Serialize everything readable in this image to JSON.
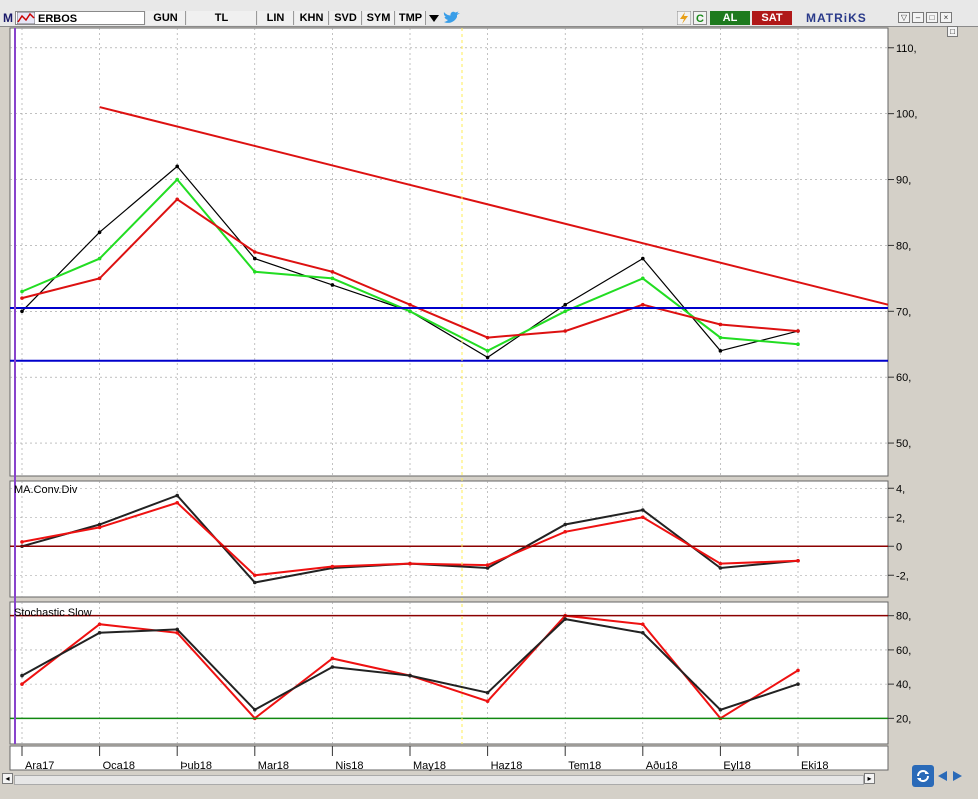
{
  "toolbar": {
    "logo": "M",
    "symbol": "ERBOS",
    "buttons": [
      "GUN",
      "TL",
      "LIN",
      "KHN",
      "SVD",
      "SYM",
      "TMP"
    ],
    "buy_label": "AL",
    "sell_label": "SAT",
    "brand": "MATRiKS",
    "refresh_label": "C"
  },
  "colors": {
    "price_bars": "#000000",
    "ma_fast": "#22dd22",
    "ma_slow": "#dd1111",
    "trendline": "#dd1111",
    "horizontal_lines": "#0000cc",
    "macd": "#222222",
    "macd_signal": "#ee1111",
    "stoch_k": "#ee1111",
    "stoch_d": "#222222",
    "zero_line": "#8b0000",
    "stoch_lower": "#118811",
    "cursor_line": "#ffee55",
    "left_marker": "#8844cc"
  },
  "chart_data": [
    {
      "type": "line",
      "name": "price",
      "x": [
        "Ara17",
        "Oca18",
        "Şub18",
        "Mar18",
        "Nis18",
        "May18",
        "Haz18",
        "Tem18",
        "Ağu18",
        "Eyl18",
        "Eki18"
      ],
      "date_labels": [
        "Ara17",
        "Oca18",
        "Þub18",
        "Mar18",
        "Nis18",
        "May18",
        "Haz18",
        "Tem18",
        "Aðu18",
        "Eyl18",
        "Eki18"
      ],
      "series": [
        {
          "values": [
            70,
            82,
            92,
            78,
            74,
            70,
            63,
            71,
            78,
            64,
            67
          ]
        },
        {
          "values": [
            73,
            78,
            90,
            76,
            75,
            70,
            64,
            70,
            75,
            66,
            65
          ]
        },
        {
          "values": [
            72,
            75,
            87,
            79,
            76,
            71,
            66,
            67,
            71,
            68,
            67
          ]
        }
      ],
      "ylim": [
        45,
        113
      ],
      "yticks": [
        50,
        60,
        70,
        80,
        90,
        100,
        110
      ],
      "ytick_labels": [
        "50,",
        "60,",
        "70,",
        "80,",
        "90,",
        "100,",
        "110,"
      ],
      "horizontal_lines": [
        70.5,
        62.5
      ],
      "trendline": {
        "from": [
          "Oca18",
          101
        ],
        "to": [
          "Eki18",
          71
        ]
      },
      "grid": true
    },
    {
      "type": "line",
      "title": "MA.Conv.Div",
      "series": [
        {
          "values": [
            0,
            1.5,
            3.5,
            -2.5,
            -1.5,
            -1.2,
            -1.5,
            1.5,
            2.5,
            -1.5,
            -1
          ]
        },
        {
          "values": [
            0.3,
            1.3,
            3,
            -2,
            -1.4,
            -1.2,
            -1.3,
            1,
            2,
            -1.2,
            -1
          ]
        }
      ],
      "ylim": [
        -3.5,
        4.5
      ],
      "yticks": [
        -2,
        0,
        2,
        4
      ],
      "ytick_labels": [
        "-2,",
        "0",
        "2,",
        "4,"
      ],
      "grid": true
    },
    {
      "type": "line",
      "title": "Stochastic Slow",
      "series": [
        {
          "values": [
            40,
            75,
            70,
            20,
            55,
            45,
            30,
            80,
            75,
            20,
            48
          ]
        },
        {
          "values": [
            45,
            70,
            72,
            25,
            50,
            45,
            35,
            78,
            70,
            25,
            40
          ]
        }
      ],
      "ylim": [
        5,
        88
      ],
      "yticks": [
        20,
        40,
        60,
        80
      ],
      "ytick_labels": [
        "20,",
        "40,",
        "60,",
        "80,"
      ],
      "grid": true
    }
  ]
}
